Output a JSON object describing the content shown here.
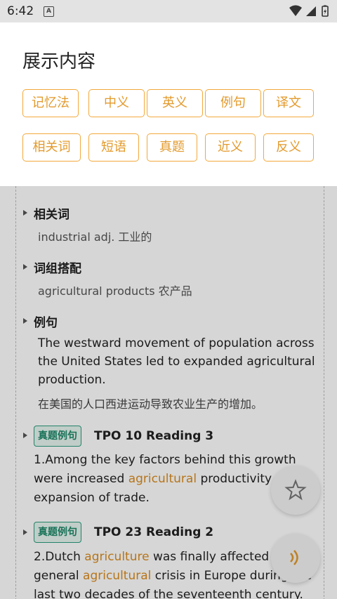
{
  "status_bar": {
    "time": "6:42",
    "notification_letter": "A"
  },
  "panel": {
    "title": "展示内容",
    "options_row1": [
      "记忆法",
      "中义",
      "英义",
      "例句",
      "译文"
    ],
    "options_row2": [
      "相关词",
      "短语",
      "真题",
      "近义",
      "反义"
    ]
  },
  "content": {
    "related_words": {
      "title": "相关词",
      "text": "industrial adj. 工业的"
    },
    "phrases": {
      "title": "词组搭配",
      "text": "agricultural products 农产品"
    },
    "examples": {
      "title": "例句",
      "english": "The westward movement of population across the United States led to expanded agricultural production.",
      "chinese": "在美国的人口西进运动导致农业生产的增加。"
    },
    "tpo": [
      {
        "badge": "真题例句",
        "ref": "TPO 10 Reading 3",
        "parts": [
          "1.Among the key factors behind this growth were increased ",
          "agricultural",
          " productivity and an expansion of trade."
        ]
      },
      {
        "badge": "真题例句",
        "ref": "TPO 23 Reading 2",
        "parts": [
          "2.Dutch ",
          "agriculture",
          " was finally affected by the general ",
          "agricultural",
          " crisis in Europe during the last two decades of the seventeenth century."
        ]
      }
    ]
  },
  "fabs": {
    "favorite_icon": "star-outline-icon",
    "audio_icon": "speaker-icon"
  },
  "colors": {
    "accent": "#f2a93b",
    "badge_green": "#1e8a6a",
    "highlight": "#d98c1f"
  }
}
